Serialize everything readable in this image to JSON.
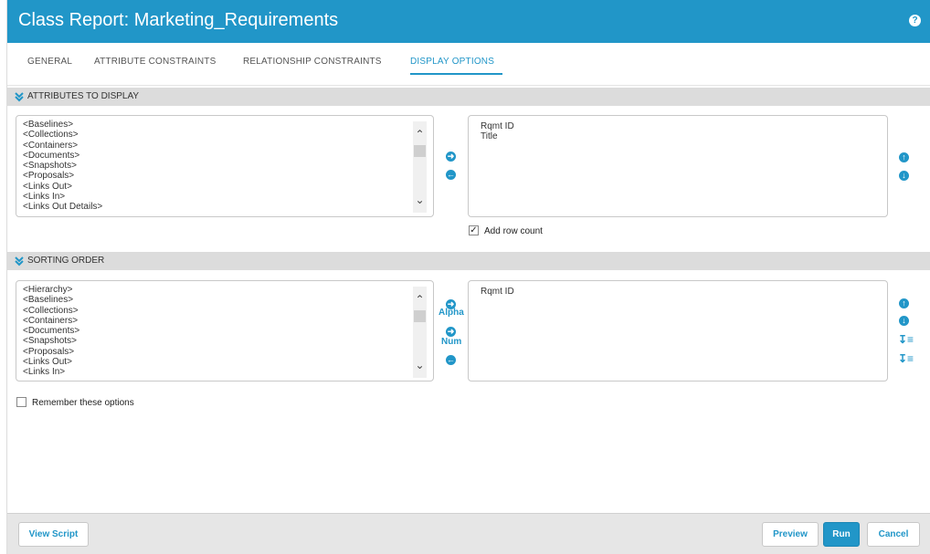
{
  "window": {
    "title": "Class Report: Marketing_Requirements",
    "help_icon": "question-circle-icon"
  },
  "tabs": [
    {
      "label": "GENERAL",
      "active": false
    },
    {
      "label": "ATTRIBUTE CONSTRAINTS",
      "active": false
    },
    {
      "label": "RELATIONSHIP CONSTRAINTS",
      "active": false
    },
    {
      "label": "DISPLAY OPTIONS",
      "active": true
    }
  ],
  "attributes_section": {
    "title": "ATTRIBUTES TO DISPLAY",
    "available": [
      "<Baselines>",
      "<Collections>",
      "<Containers>",
      "<Documents>",
      "<Snapshots>",
      "<Proposals>",
      "<Links Out>",
      "<Links In>",
      "<Links Out Details>"
    ],
    "selected": [
      "Rqmt ID",
      "Title"
    ],
    "add_row_count": {
      "label": "Add row count",
      "checked": true
    }
  },
  "sorting_section": {
    "title": "SORTING ORDER",
    "available": [
      "<Hierarchy>",
      "<Baselines>",
      "<Collections>",
      "<Containers>",
      "<Documents>",
      "<Snapshots>",
      "<Proposals>",
      "<Links Out>",
      "<Links In>"
    ],
    "selected": [
      "Rqmt ID"
    ],
    "alpha_label": "Alpha",
    "num_label": "Num"
  },
  "remember": {
    "label": "Remember these options",
    "checked": false
  },
  "footer": {
    "view_script": "View Script",
    "preview": "Preview",
    "run": "Run",
    "cancel": "Cancel"
  },
  "colors": {
    "accent": "#2196c8",
    "section_bg": "#dcdcdc",
    "footer_bg": "#e6e6e6"
  }
}
